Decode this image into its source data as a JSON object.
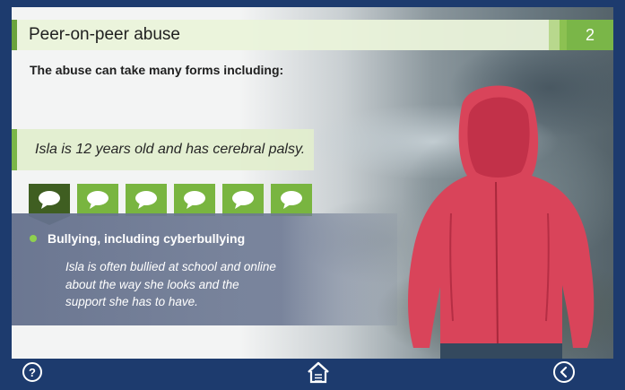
{
  "header": {
    "title": "Peer-on-peer abuse",
    "page_number": "2"
  },
  "intro": "The abuse can take many forms including:",
  "quote": "Isla is 12 years old and has cerebral palsy.",
  "tabs": [
    {
      "icon": "speech-bubble-icon",
      "active": true
    },
    {
      "icon": "speech-bubble-icon",
      "active": false
    },
    {
      "icon": "speech-bubble-icon",
      "active": false
    },
    {
      "icon": "speech-bubble-icon",
      "active": false
    },
    {
      "icon": "speech-bubble-icon",
      "active": false
    },
    {
      "icon": "speech-bubble-icon",
      "active": false
    }
  ],
  "content": {
    "heading": "Bullying, including cyberbullying",
    "body": "Isla is often bullied at school and online about the way she looks and the support she has to have."
  },
  "footer": {
    "help_label": "?",
    "home_icon": "home-icon",
    "back_icon": "back-arrow-icon"
  },
  "colors": {
    "navy": "#1d3b6e",
    "green": "#7ab648",
    "dark_green": "#3f5e21",
    "jacket": "#d9445a"
  }
}
